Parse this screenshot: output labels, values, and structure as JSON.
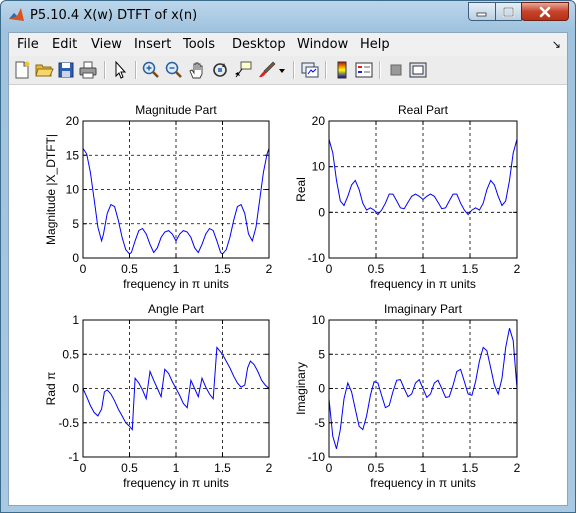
{
  "window": {
    "title": "P5.10.4 X(w) DTFT of x(n)",
    "controls": [
      "minimize",
      "maximize",
      "close"
    ]
  },
  "menubar": {
    "items": [
      "File",
      "Edit",
      "View",
      "Insert",
      "Tools",
      "Desktop",
      "Window",
      "Help"
    ]
  },
  "toolbar": {
    "icons": [
      "new-figure-icon",
      "open-file-icon",
      "save-icon",
      "print-icon",
      "pointer-icon",
      "zoom-in-icon",
      "zoom-out-icon",
      "pan-hand-icon",
      "rotate-3d-icon",
      "data-cursor-icon",
      "brush-icon",
      "dropdown-arrow-icon",
      "link-plot-icon",
      "colorbar-icon",
      "legend-icon",
      "hide-plot-tools-icon",
      "show-plot-tools-icon"
    ]
  },
  "colors": {
    "line": "#0000ff",
    "grid": "#000000",
    "axes_bg": "#ffffff"
  },
  "chart_data": [
    {
      "type": "line",
      "title": "Magnitude Part",
      "xlabel": "frequency in π units",
      "ylabel": "Magnitude  |X_DTFT|",
      "xlim": [
        0,
        2
      ],
      "ylim": [
        0,
        20
      ],
      "xticks": [
        "0",
        "0.5",
        "1",
        "1.5",
        "2"
      ],
      "yticks": [
        "0",
        "5",
        "10",
        "15",
        "20"
      ],
      "grid": true,
      "x": [
        0,
        0.04,
        0.08,
        0.12,
        0.16,
        0.2,
        0.22,
        0.26,
        0.3,
        0.34,
        0.38,
        0.42,
        0.46,
        0.5,
        0.52,
        0.56,
        0.6,
        0.64,
        0.68,
        0.72,
        0.76,
        0.8,
        0.84,
        0.88,
        0.92,
        0.96,
        1.0,
        1.04,
        1.08,
        1.12,
        1.16,
        1.2,
        1.24,
        1.28,
        1.32,
        1.36,
        1.4,
        1.44,
        1.48,
        1.5,
        1.54,
        1.58,
        1.62,
        1.66,
        1.7,
        1.74,
        1.78,
        1.82,
        1.86,
        1.9,
        1.94,
        1.98,
        2.0
      ],
      "y": [
        16,
        15.2,
        12.5,
        8.5,
        4.5,
        2.5,
        3.5,
        6.5,
        7.8,
        7.5,
        5.5,
        3.0,
        1.2,
        0.6,
        0.8,
        2.5,
        4.0,
        4.3,
        3.5,
        2.0,
        0.8,
        1.5,
        3.0,
        3.8,
        4.0,
        3.5,
        2.5,
        3.5,
        4.0,
        3.8,
        3.0,
        1.5,
        0.8,
        2.0,
        3.5,
        4.3,
        4.0,
        2.5,
        0.8,
        0.6,
        1.2,
        3.0,
        5.5,
        7.5,
        7.8,
        6.5,
        3.5,
        2.5,
        4.5,
        8.5,
        12.5,
        15.2,
        16
      ]
    },
    {
      "type": "line",
      "title": "Real Part",
      "xlabel": "frequency in π units",
      "ylabel": "Real",
      "xlim": [
        0,
        2
      ],
      "ylim": [
        -10,
        20
      ],
      "xticks": [
        "0",
        "0.5",
        "1",
        "1.5",
        "2"
      ],
      "yticks": [
        "-10",
        "0",
        "10",
        "20"
      ],
      "grid": true,
      "x": [
        0,
        0.04,
        0.08,
        0.12,
        0.16,
        0.2,
        0.24,
        0.28,
        0.32,
        0.36,
        0.4,
        0.44,
        0.48,
        0.52,
        0.56,
        0.6,
        0.64,
        0.68,
        0.72,
        0.76,
        0.8,
        0.84,
        0.88,
        0.92,
        0.96,
        1.0,
        1.04,
        1.08,
        1.12,
        1.16,
        1.2,
        1.24,
        1.28,
        1.32,
        1.36,
        1.4,
        1.44,
        1.48,
        1.52,
        1.56,
        1.6,
        1.64,
        1.68,
        1.72,
        1.76,
        1.8,
        1.84,
        1.88,
        1.92,
        1.96,
        2.0
      ],
      "y": [
        16,
        13,
        7,
        2.5,
        1.5,
        3.5,
        6,
        7,
        5,
        2,
        0.5,
        1,
        0.5,
        -0.5,
        0.5,
        2,
        4,
        4,
        2.5,
        1,
        0.8,
        2.2,
        3.5,
        4,
        3.5,
        2.8,
        3.5,
        4,
        3.5,
        2.2,
        0.8,
        1,
        2.5,
        4,
        4,
        2,
        0.5,
        -0.5,
        0.5,
        1,
        0.5,
        2,
        5,
        7,
        6,
        3.5,
        1.5,
        2.5,
        7,
        13,
        16
      ]
    },
    {
      "type": "line",
      "title": "Angle Part",
      "xlabel": "frequency in π units",
      "ylabel": "Rad π",
      "xlim": [
        0,
        2
      ],
      "ylim": [
        -1,
        1
      ],
      "xticks": [
        "0",
        "0.5",
        "1",
        "1.5",
        "2"
      ],
      "yticks": [
        "-1",
        "-0.5",
        "0",
        "0.5",
        "1"
      ],
      "grid": true,
      "x": [
        0,
        0.04,
        0.08,
        0.12,
        0.16,
        0.2,
        0.23,
        0.26,
        0.3,
        0.34,
        0.38,
        0.42,
        0.46,
        0.5,
        0.53,
        0.56,
        0.6,
        0.64,
        0.68,
        0.72,
        0.76,
        0.8,
        0.84,
        0.88,
        0.92,
        0.96,
        1.0,
        1.04,
        1.08,
        1.12,
        1.16,
        1.2,
        1.24,
        1.28,
        1.32,
        1.36,
        1.4,
        1.44,
        1.47,
        1.5,
        1.54,
        1.58,
        1.62,
        1.66,
        1.7,
        1.74,
        1.77,
        1.8,
        1.84,
        1.88,
        1.92,
        1.96,
        2.0
      ],
      "y": [
        0,
        -0.12,
        -0.25,
        -0.35,
        -0.4,
        -0.3,
        -0.05,
        -0.02,
        -0.08,
        -0.18,
        -0.3,
        -0.4,
        -0.5,
        -0.55,
        -0.6,
        0.15,
        0.08,
        -0.02,
        -0.15,
        0.25,
        0.12,
        0.0,
        -0.12,
        0.28,
        0.22,
        0.1,
        0.0,
        -0.1,
        -0.22,
        -0.28,
        0.12,
        0.0,
        -0.12,
        0.15,
        0.02,
        -0.08,
        -0.15,
        0.6,
        0.55,
        0.5,
        0.4,
        0.3,
        0.18,
        0.08,
        0.02,
        0.05,
        0.3,
        0.4,
        0.35,
        0.25,
        0.12,
        0.05,
        0
      ]
    },
    {
      "type": "line",
      "title": "Imaginary Part",
      "xlabel": "frequency in π units",
      "ylabel": "Imaginary",
      "xlim": [
        0,
        2
      ],
      "ylim": [
        -10,
        10
      ],
      "xticks": [
        "0",
        "0.5",
        "1",
        "1.5",
        "2"
      ],
      "yticks": [
        "-10",
        "-5",
        "0",
        "5",
        "10"
      ],
      "grid": true,
      "x": [
        0,
        0.04,
        0.08,
        0.12,
        0.16,
        0.2,
        0.24,
        0.28,
        0.32,
        0.36,
        0.4,
        0.44,
        0.48,
        0.52,
        0.56,
        0.6,
        0.64,
        0.68,
        0.72,
        0.76,
        0.8,
        0.84,
        0.88,
        0.92,
        0.96,
        1.0,
        1.04,
        1.08,
        1.12,
        1.16,
        1.2,
        1.24,
        1.28,
        1.32,
        1.36,
        1.4,
        1.44,
        1.48,
        1.52,
        1.56,
        1.6,
        1.64,
        1.68,
        1.72,
        1.76,
        1.8,
        1.84,
        1.88,
        1.92,
        1.96,
        2.0
      ],
      "y": [
        -1.5,
        -7,
        -8.8,
        -6,
        -1.5,
        0.8,
        -0.5,
        -3,
        -5.5,
        -6,
        -4,
        -1,
        1,
        0.8,
        -1,
        -2.8,
        -2.5,
        -0.5,
        1.2,
        1.3,
        0,
        -1.2,
        -0.8,
        0.8,
        1.3,
        0,
        -1.3,
        -0.8,
        0.8,
        1.2,
        0,
        -1.3,
        -1.2,
        0.5,
        2.5,
        2.8,
        1,
        -0.8,
        -1,
        1,
        4,
        6,
        5.5,
        3,
        0.5,
        -0.8,
        1.5,
        6,
        8.8,
        7,
        0
      ]
    }
  ]
}
